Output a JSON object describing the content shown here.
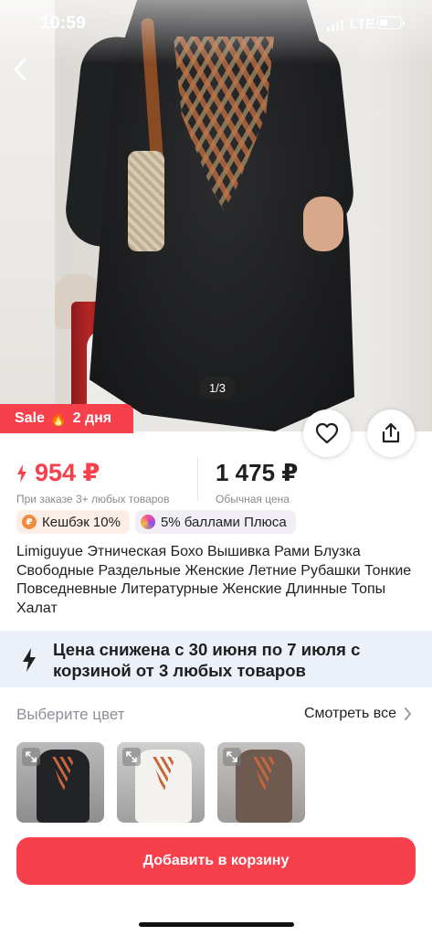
{
  "status_bar": {
    "time": "10:59",
    "network": "LTE"
  },
  "gallery": {
    "page_indicator": "1/3"
  },
  "sale_badge": {
    "label": "Sale",
    "duration": "2 дня"
  },
  "price": {
    "current": "954 ₽",
    "current_note": "При заказе 3+ любых товаров",
    "regular": "1 475 ₽",
    "regular_note": "Обычная цена",
    "accent_color": "#f6404b"
  },
  "chips": {
    "cashback": "Кешбэк 10%",
    "plus_points": "5% баллами Плюса"
  },
  "product": {
    "title": "Limiguyue Этническая Бохо Вышивка Рами Блузка Свободные Раздельные Женские Летние Рубашки Тонкие Повседневные Литературные Женские Длинные Топы Халат"
  },
  "promo": {
    "text": "Цена снижена с 30 июня по 7 июля с корзиной от 3 любых товаров"
  },
  "color_section": {
    "heading": "Выберите цвет",
    "see_all": "Смотреть все"
  },
  "actions": {
    "add_to_cart": "Добавить в корзину"
  },
  "icons": {
    "back": "chevron-left-icon",
    "favorite": "heart-icon",
    "share": "share-icon",
    "fire": "fire-icon",
    "bolt": "lightning-icon",
    "expand": "expand-icon"
  }
}
